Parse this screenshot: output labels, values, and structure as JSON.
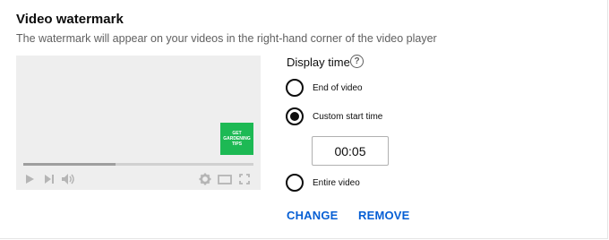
{
  "section": {
    "title": "Video watermark",
    "subtitle": "The watermark will appear on your videos in the right-hand corner of the video player"
  },
  "preview": {
    "watermark_lines": [
      "GET",
      "GARDENING",
      "TIPS"
    ],
    "watermark_color": "#1db954",
    "progress_fraction": 0.4,
    "icons": [
      "play-icon",
      "next-icon",
      "volume-icon",
      "settings-icon",
      "theater-mode-icon",
      "fullscreen-icon"
    ]
  },
  "display_time": {
    "label": "Display time",
    "help_glyph": "?",
    "options": [
      {
        "label": "End of video",
        "selected": false
      },
      {
        "label": "Custom start time",
        "selected": true
      },
      {
        "label": "Entire video",
        "selected": false
      }
    ],
    "start_time_value": "00:05"
  },
  "actions": {
    "change_label": "CHANGE",
    "remove_label": "REMOVE"
  },
  "colors": {
    "accent": "#065fd4",
    "text": "#0d0d0d",
    "muted": "#606060"
  }
}
